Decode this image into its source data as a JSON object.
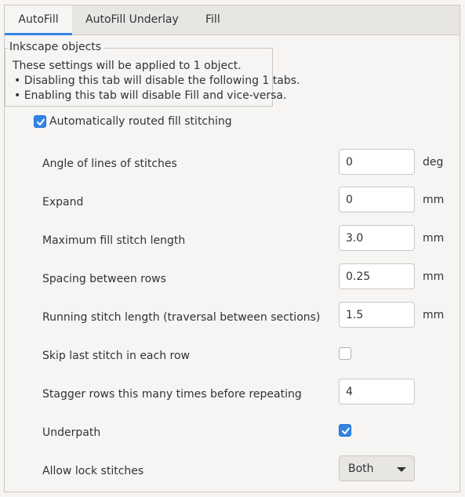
{
  "tabs": [
    {
      "label": "AutoFill",
      "active": true
    },
    {
      "label": "AutoFill Underlay",
      "active": false
    },
    {
      "label": "Fill",
      "active": false
    }
  ],
  "info_frame": {
    "title": "Inkscape objects",
    "lines": [
      "These settings will be applied to 1 object.",
      "• Disabling this tab will disable the following 1 tabs.",
      "• Enabling this tab will disable Fill and vice-versa."
    ]
  },
  "auto_routed": {
    "label": "Automatically routed fill stitching",
    "checked": true
  },
  "params": {
    "angle": {
      "label": "Angle of lines of stitches",
      "value": "0",
      "unit": "deg"
    },
    "expand": {
      "label": "Expand",
      "value": "0",
      "unit": "mm"
    },
    "max_stitch": {
      "label": "Maximum fill stitch length",
      "value": "3.0",
      "unit": "mm"
    },
    "row_spacing": {
      "label": "Spacing between rows",
      "value": "0.25",
      "unit": "mm"
    },
    "running_stitch": {
      "label": "Running stitch length (traversal between sections)",
      "value": "1.5",
      "unit": "mm"
    },
    "skip_last": {
      "label": "Skip last stitch in each row",
      "checked": false
    },
    "stagger": {
      "label": "Stagger rows this many times before repeating",
      "value": "4"
    },
    "underpath": {
      "label": "Underpath",
      "checked": true
    },
    "lock_stitches": {
      "label": "Allow lock stitches",
      "selected": "Both"
    }
  },
  "colors": {
    "accent": "#3584e4"
  }
}
